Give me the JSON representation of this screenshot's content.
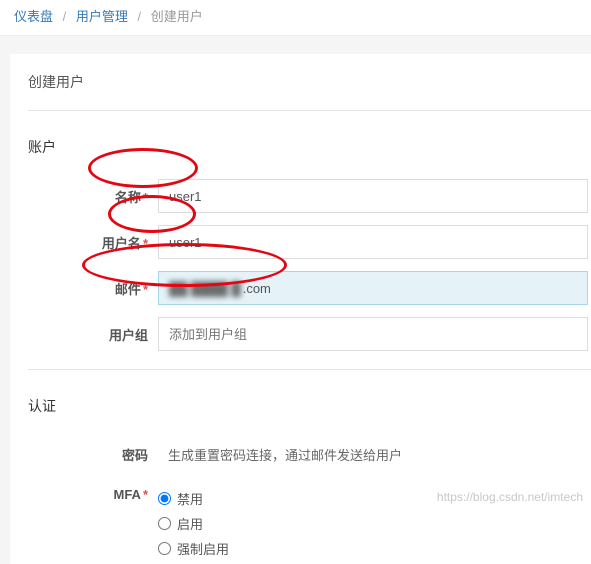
{
  "breadcrumb": {
    "items": [
      {
        "label": "仪表盘",
        "link": true
      },
      {
        "label": "用户管理",
        "link": true
      },
      {
        "label": "创建用户",
        "link": false
      }
    ]
  },
  "page_title": "创建用户",
  "sections": {
    "account": {
      "title": "账户",
      "fields": {
        "name": {
          "label": "名称",
          "required": true,
          "value": "user1"
        },
        "username": {
          "label": "用户名",
          "required": true,
          "value": "user1"
        },
        "email": {
          "label": "邮件",
          "required": true,
          "value_suffix": ".com"
        },
        "group": {
          "label": "用户组",
          "required": false,
          "placeholder": "添加到用户组"
        }
      }
    },
    "auth": {
      "title": "认证",
      "fields": {
        "password": {
          "label": "密码",
          "required": false,
          "desc": "生成重置密码连接，通过邮件发送给用户"
        },
        "mfa": {
          "label": "MFA",
          "required": true,
          "options": [
            {
              "label": "禁用",
              "checked": true
            },
            {
              "label": "启用",
              "checked": false
            },
            {
              "label": "强制启用",
              "checked": false
            }
          ]
        }
      }
    }
  },
  "watermark": "https://blog.csdn.net/imtech"
}
